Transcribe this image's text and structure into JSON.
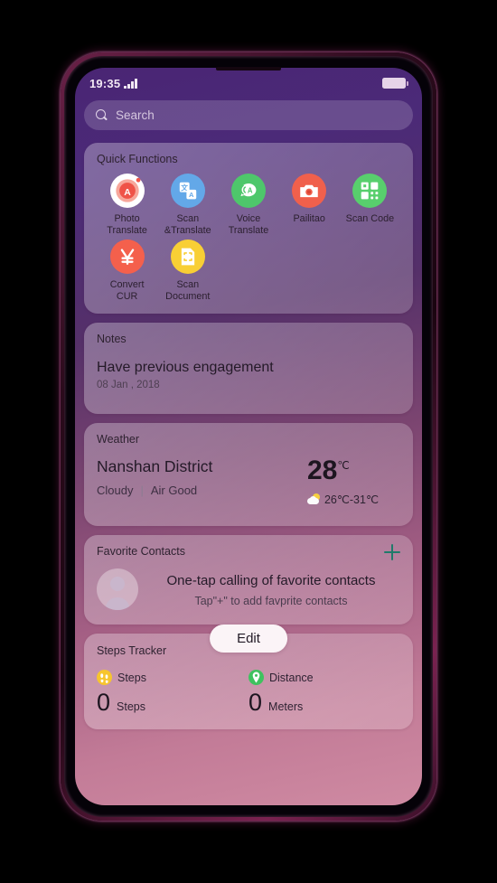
{
  "status_bar": {
    "time": "19:35",
    "signal_icon": "signal-bars-icon",
    "battery_icon": "battery-icon"
  },
  "search": {
    "placeholder": "Search",
    "icon": "search-icon"
  },
  "quick_functions": {
    "title": "Quick Functions",
    "items": [
      {
        "label": "Photo\nTranslate",
        "icon": "photo-translate-icon",
        "color": "#ffffff",
        "inner": "#f2564a"
      },
      {
        "label": "Scan\n&Translate",
        "icon": "scan-translate-icon",
        "color": "#63a8e8",
        "inner": "#ffffff"
      },
      {
        "label": "Voice\nTranslate",
        "icon": "voice-translate-icon",
        "color": "#4ec76b",
        "inner": "#ffffff"
      },
      {
        "label": "Pailitao",
        "icon": "pailitao-camera-icon",
        "color": "#f0604c",
        "inner": "#ffffff"
      },
      {
        "label": "Scan Code",
        "icon": "scan-code-qr-icon",
        "color": "#58cf6d",
        "inner": "#ffffff"
      },
      {
        "label": "Convert\nCUR",
        "icon": "convert-currency-icon",
        "color": "#f4604c",
        "inner": "#ffffff"
      },
      {
        "label": "Scan\nDocument",
        "icon": "scan-document-icon",
        "color": "#f8cf35",
        "inner": "#ffffff"
      }
    ]
  },
  "notes": {
    "title": "Notes",
    "content": "Have previous engagement",
    "date": "08 Jan , 2018"
  },
  "weather": {
    "title": "Weather",
    "city": "Nanshan District",
    "condition": "Cloudy",
    "separator": "|",
    "air_quality": "Air Good",
    "temperature": "28",
    "temperature_unit": "℃",
    "range": "26℃-31℃",
    "range_icon": "sun-behind-cloud-icon"
  },
  "favorite_contacts": {
    "title": "Favorite Contacts",
    "add_icon": "plus-icon",
    "avatar_icon": "avatar-placeholder-icon",
    "headline": "One-tap calling of favorite contacts",
    "subtext": "Tap\"+\" to add favprite contacts"
  },
  "steps_tracker": {
    "title": "Steps Tracker",
    "edit_label": "Edit",
    "metrics": [
      {
        "icon": "footsteps-icon",
        "icon_color": "#f7c52e",
        "label": "Steps",
        "value": "0",
        "unit": "Steps"
      },
      {
        "icon": "distance-pin-icon",
        "icon_color": "#3fc25f",
        "label": "Distance",
        "value": "0",
        "unit": "Meters"
      }
    ]
  },
  "theme": {
    "accent_plus": "#1f7a6a",
    "screen_gradient_top": "#4a2574",
    "screen_gradient_bottom": "#cf8aa2",
    "bezel": "#050208"
  }
}
